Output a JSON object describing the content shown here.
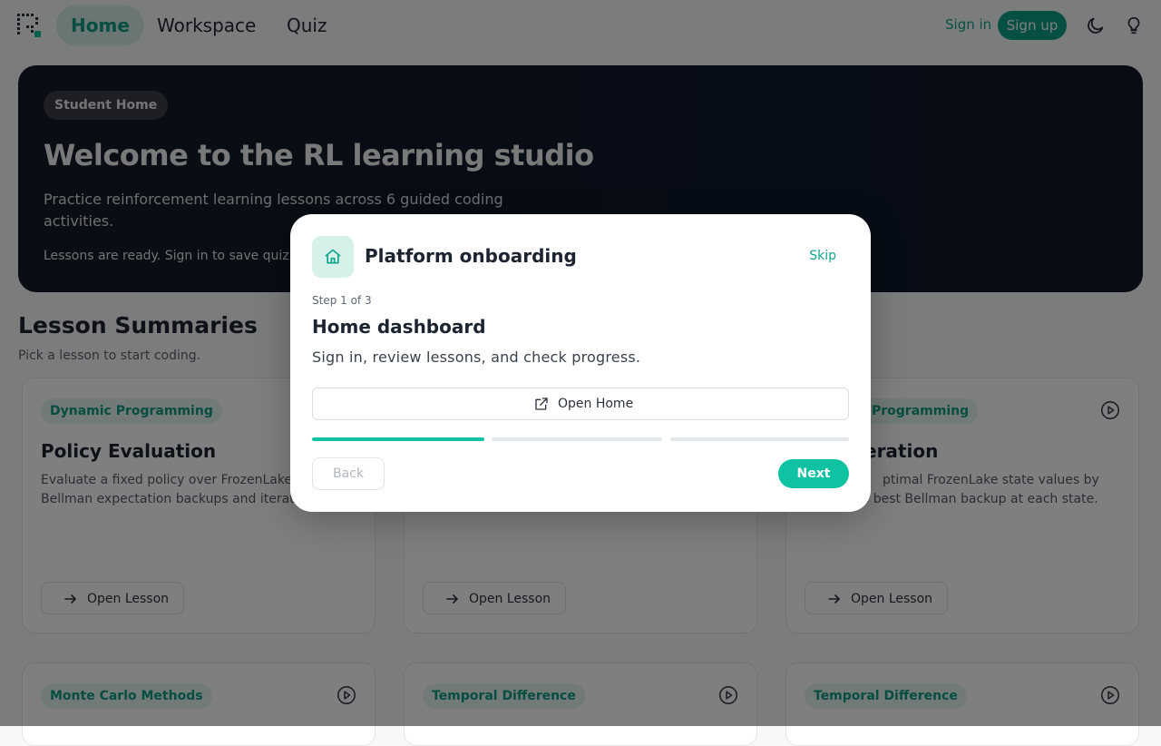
{
  "header": {
    "nav": [
      {
        "label": "Home",
        "active": true
      },
      {
        "label": "Workspace",
        "active": false
      },
      {
        "label": "Quiz",
        "active": false
      }
    ],
    "sign_in": "Sign in",
    "sign_up": "Sign up",
    "icons": [
      "logo-icon",
      "moon-icon",
      "lightbulb-icon"
    ]
  },
  "hero": {
    "badge": "Student Home",
    "title": "Welcome to the RL learning studio",
    "subtitle": "Practice reinforcement learning lessons across 6 guided coding activities.",
    "note": "Lessons are ready. Sign in to save quiz re"
  },
  "section": {
    "title": "Lesson Summaries",
    "subtitle": "Pick a lesson to start coding."
  },
  "cards": [
    {
      "tag": "Dynamic Programming",
      "title": "Policy Evaluation",
      "desc": "Evaluate a fixed policy over FrozenLake using Bellman expectation backups and iterative",
      "button": "Open Lesson"
    },
    {
      "tag": "",
      "title": "",
      "desc": "",
      "button": "Open Lesson"
    },
    {
      "tag": "Programming",
      "title": "eration",
      "desc": "ptimal FrozenLake state values by taking the best Bellman backup at each state.",
      "button": "Open Lesson"
    },
    {
      "tag": "Monte Carlo Methods"
    },
    {
      "tag": "Temporal Difference"
    },
    {
      "tag": "Temporal Difference"
    }
  ],
  "modal": {
    "title": "Platform onboarding",
    "skip": "Skip",
    "step": "Step 1 of 3",
    "heading": "Home dashboard",
    "description": "Sign in, review lessons, and check progress.",
    "open_button": "Open Home",
    "progress": {
      "current_step": 1,
      "total_steps": 3
    },
    "back": "Back",
    "next": "Next"
  },
  "colors": {
    "accent": "#0ec2a2",
    "accent_dark": "#0a9e87",
    "hero_bg": "#121a28",
    "tag_bg": "#e2f4ef"
  }
}
